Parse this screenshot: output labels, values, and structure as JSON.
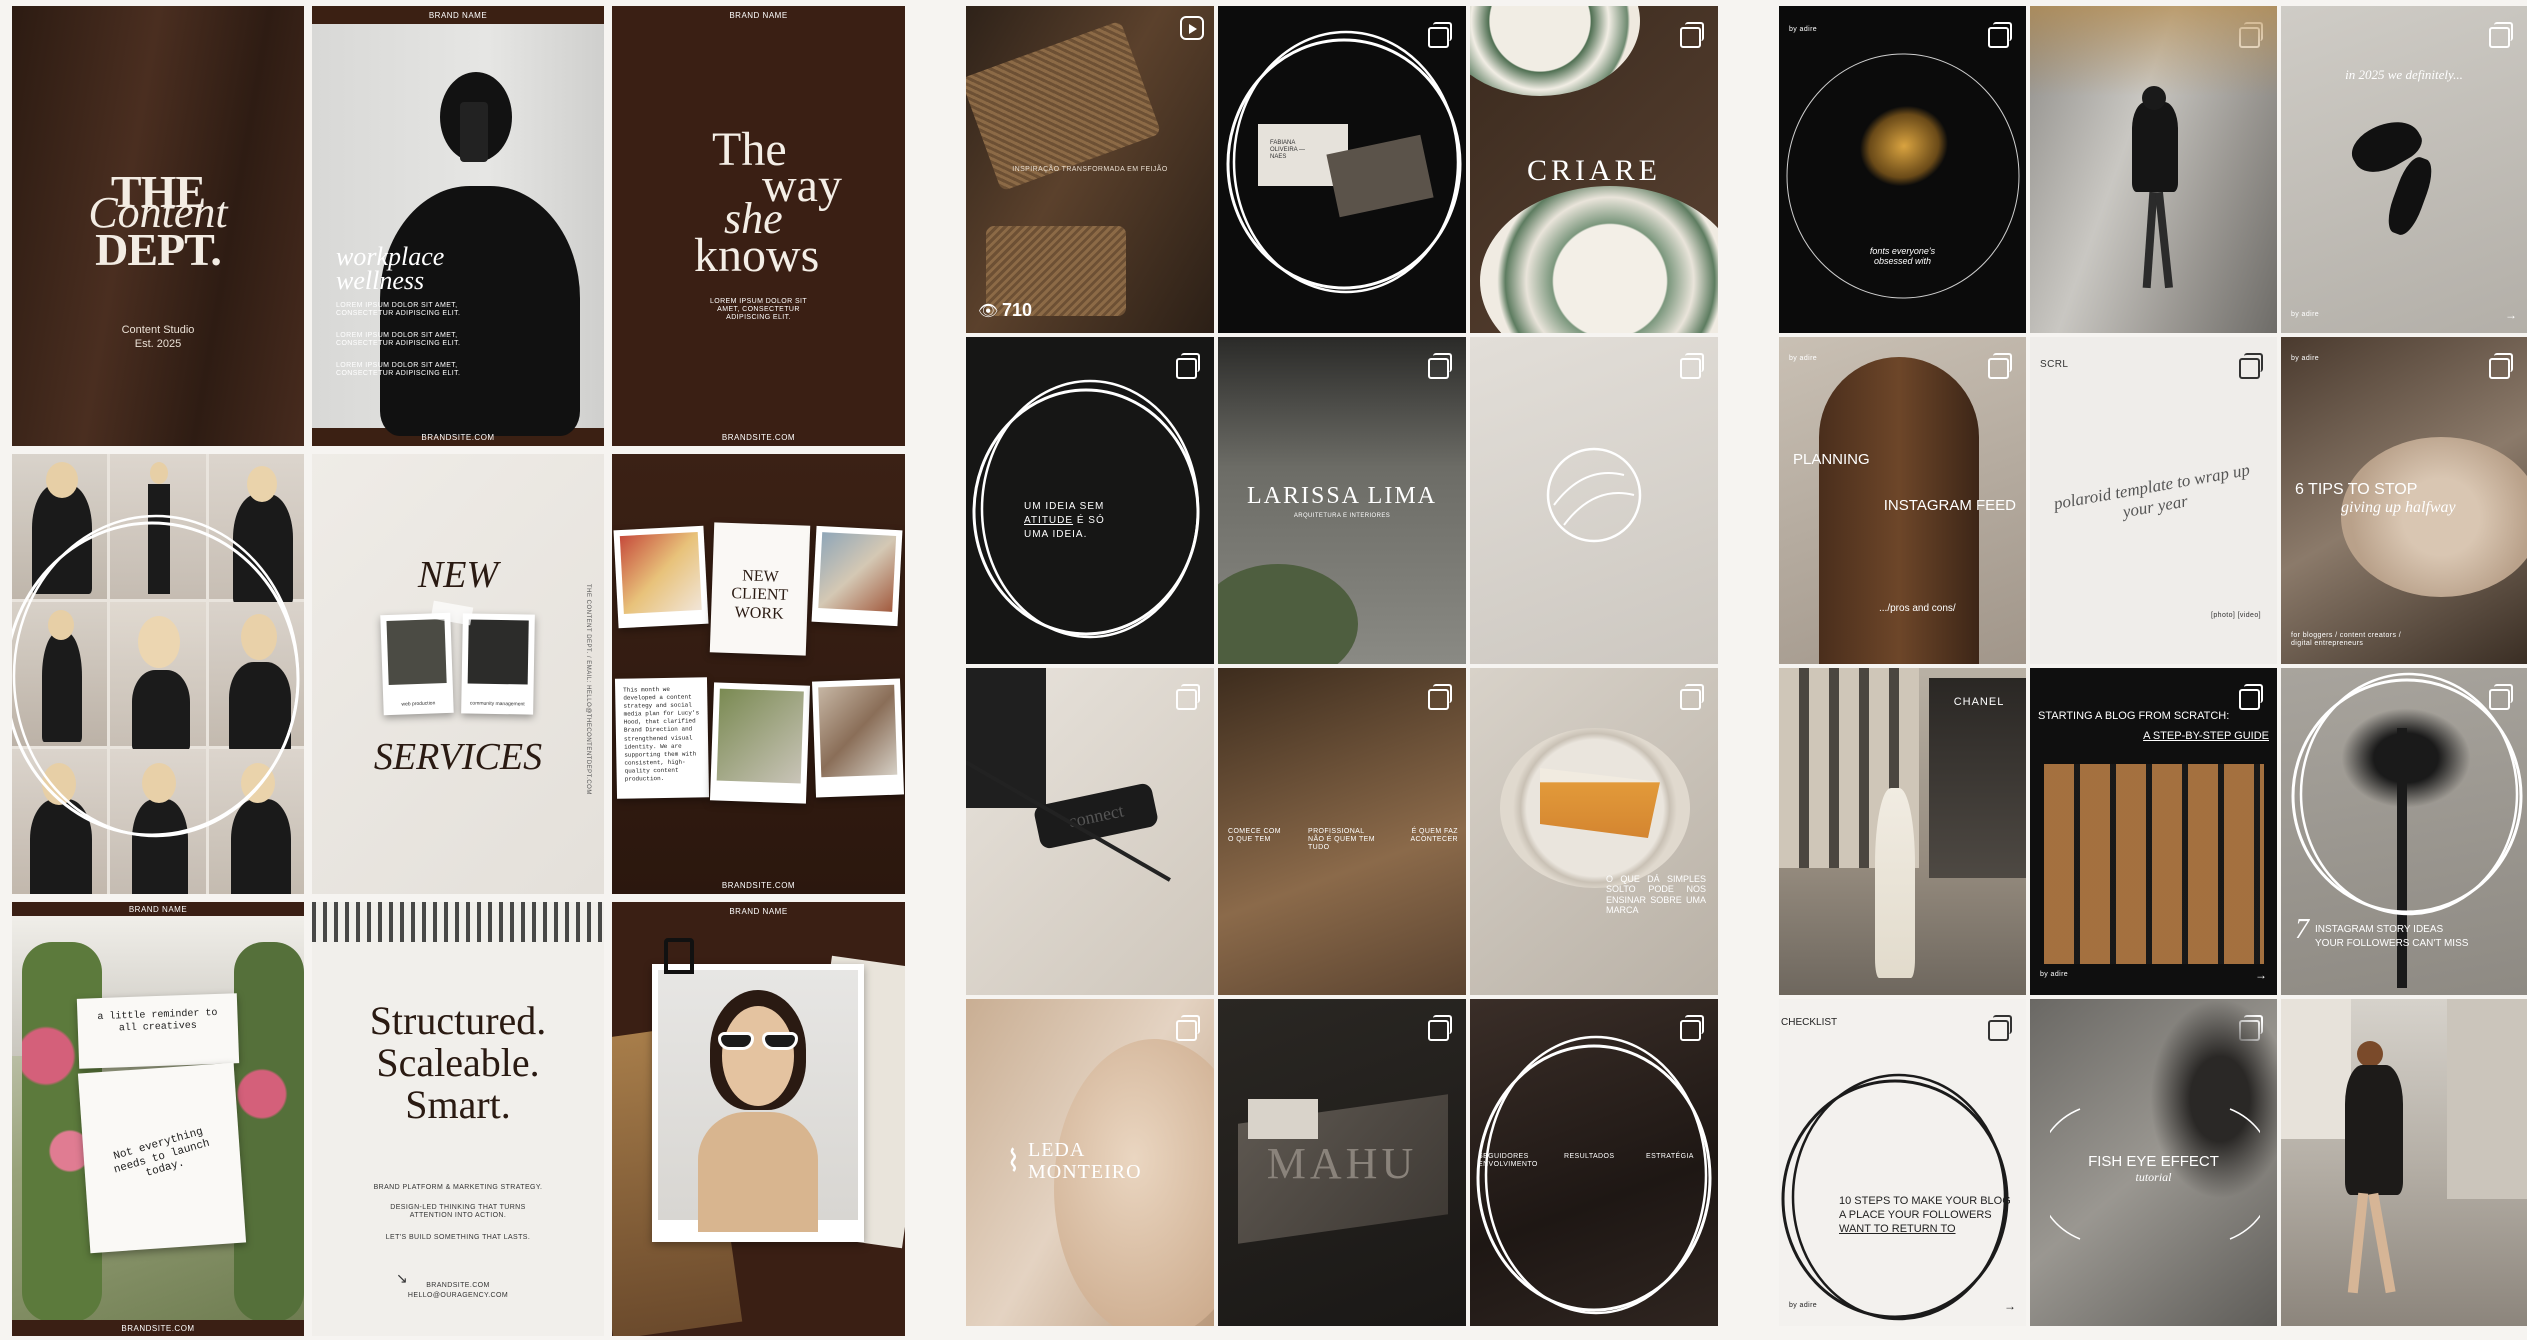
{
  "board1": {
    "t1": {
      "logo_a": "THE",
      "logo_script": "Content",
      "logo_b": "DEPT.",
      "studio": "Content Studio",
      "est": "Est. 2025"
    },
    "t2": {
      "brand": "BRAND NAME",
      "title_a": "workplace",
      "title_b": "wellness",
      "body1": "LOREM IPSUM DOLOR SIT AMET, CONSECTETUR ADIPISCING ELIT.",
      "body2": "LOREM IPSUM DOLOR SIT AMET, CONSECTETUR ADIPISCING ELIT.",
      "body3": "LOREM IPSUM DOLOR SIT AMET, CONSECTETUR ADIPISCING ELIT.",
      "site": "BRANDSITE.COM"
    },
    "t3": {
      "brand": "BRAND NAME",
      "l1": "The",
      "l2": "way",
      "l3": "she",
      "l4": "knows",
      "body": "LOREM IPSUM DOLOR SIT AMET, CONSECTETUR ADIPISCING ELIT.",
      "site": "BRANDSITE.COM"
    },
    "t5": {
      "new": "NEW",
      "services": "SERVICES",
      "cap1": "web production",
      "cap2": "community management",
      "side": "THE CONTENT DEPT. / EMAIL: HELLO@THECONTENTDEPT.COM"
    },
    "t6": {
      "card": "NEW CLIENT WORK",
      "note": "This month we developed a content strategy and social media plan for Lucy's Hood, that clarified Brand Direction and strengthened visual identity. We are supporting them with consistent, high-quality content production.",
      "site": "BRANDSITE.COM"
    },
    "t7": {
      "brand": "BRAND NAME",
      "note1": "a little reminder to all creatives",
      "note2": "Not everything needs to launch today.",
      "site": "BRANDSITE.COM"
    },
    "t8": {
      "h1": "Structured.",
      "h2": "Scaleable.",
      "h3": "Smart.",
      "p1": "BRAND PLATFORM & MARKETING STRATEGY.",
      "p2": "DESIGN-LED THINKING THAT TURNS ATTENTION INTO ACTION.",
      "p3": "LET'S BUILD SOMETHING THAT LASTS.",
      "site": "BRANDSITE.COM",
      "email": "HELLO@OURAGENCY.COM"
    },
    "t9": {
      "brand": "BRAND NAME"
    }
  },
  "board2": {
    "t1": {
      "caption": "INSPIRAÇÃO TRANSFORMADA EM FEIJÃO",
      "views": "710"
    },
    "t2": {
      "card": "FABIANA OLIVEIRA — NAES"
    },
    "t3": {
      "brand": "CRIARE"
    },
    "t4": {
      "l1": "UM  IDEIA  SEM",
      "l2": "ATITUDE",
      "l2b": " É SÓ",
      "l3": "UMA IDEIA."
    },
    "t5": {
      "name": "LARISSA LIMA",
      "sub": "ARQUITETURA E INTERIORES"
    },
    "t8": {
      "c1": "COMECE COM O QUE TEM",
      "c2": "PROFISSIONAL NÃO É QUEM TEM TUDO",
      "c3": "É QUEM FAZ ACONTECER"
    },
    "t9": {
      "text": "O QUE DÁ SIMPLES SOLTO PODE NOS ENSINAR SOBRE UMA MARCA"
    },
    "t10": {
      "name_a": "LEDA",
      "name_b": "MONTEIRO"
    },
    "t11": {
      "brand": "MAHU"
    },
    "t12": {
      "c1": "SEGUIDORES ENVOLVIMENTO",
      "c2": "RESULTADOS",
      "c3": "ESTRATÉGIA"
    }
  },
  "board3": {
    "t1": {
      "by": "by adire",
      "text": "fonts everyone's obsessed with"
    },
    "t3": {
      "script": "in 2025 we definitely...",
      "by": "by adire"
    },
    "t4": {
      "by": "by adire",
      "planning": "PLANNING",
      "feed": "INSTAGRAM FEED",
      "pros": ".../pros and cons/"
    },
    "t5": {
      "tag": "SCRL",
      "script": "polaroid template to wrap up your year",
      "foot": "[photo] [video]"
    },
    "t6": {
      "by": "by adire",
      "title": "6 TIPS TO STOP",
      "script": "giving up halfway",
      "foot": "for bloggers / content creators / digital entrepreneurs"
    },
    "t8": {
      "title": "STARTING A BLOG FROM SCRATCH:",
      "sub": "A STEP-BY-STEP GUIDE",
      "by": "by adire"
    },
    "t9": {
      "num": "7",
      "l1": "INSTAGRAM STORY IDEAS",
      "l2": "YOUR FOLLOWERS CAN'T MISS"
    },
    "t10": {
      "tag": "CHECKLIST",
      "l1": "10 STEPS TO MAKE YOUR BLOG",
      "l2": "A PLACE YOUR FOLLOWERS",
      "l3": "WANT TO RETURN TO",
      "by": "by adire"
    },
    "t11": {
      "title": "FISH EYE EFFECT",
      "script": "tutorial"
    }
  }
}
